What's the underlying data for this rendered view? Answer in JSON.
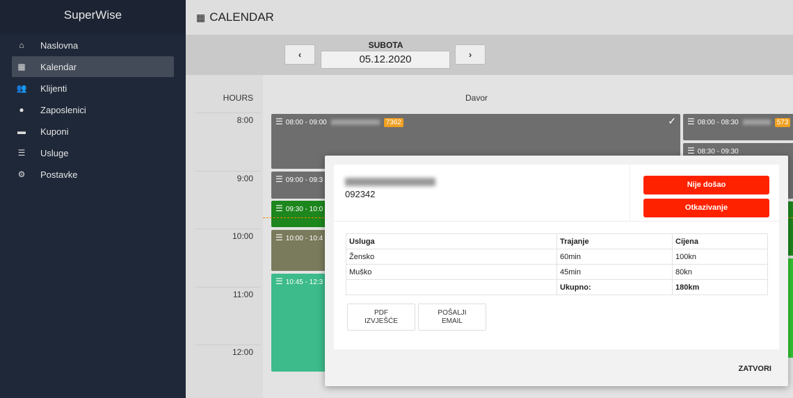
{
  "sidebar": {
    "brand": "SuperWise",
    "items": [
      {
        "label": "Naslovna",
        "icon": "home-icon",
        "glyph": "⌂"
      },
      {
        "label": "Kalendar",
        "icon": "calendar-icon",
        "glyph": "▦",
        "active": true
      },
      {
        "label": "Klijenti",
        "icon": "users-icon",
        "glyph": "👥"
      },
      {
        "label": "Zaposlenici",
        "icon": "user-icon",
        "glyph": "●"
      },
      {
        "label": "Kuponi",
        "icon": "ticket-icon",
        "glyph": "▬"
      },
      {
        "label": "Usluge",
        "icon": "list-icon",
        "glyph": "☰"
      },
      {
        "label": "Postavke",
        "icon": "gear-icon",
        "glyph": "⚙"
      }
    ]
  },
  "header": {
    "title": "CALENDAR",
    "icon": "calendar-icon"
  },
  "datenav": {
    "prev": "‹",
    "next": "›",
    "day": "SUBOTA",
    "date": "05.12.2020"
  },
  "calendar": {
    "hours_label": "HOURS",
    "hours": [
      "8:00",
      "9:00",
      "10:00",
      "11:00",
      "12:00"
    ],
    "column": "Davor",
    "events": [
      {
        "time": "08:00 - 09:00",
        "badge": "7362",
        "checked": true,
        "color": "#6e6e6e"
      },
      {
        "time": "09:00 - 09:3",
        "color": "#6e6e6e"
      },
      {
        "time": "09:30 - 10:0",
        "color": "#1d861d"
      },
      {
        "time": "10:00 - 10:4",
        "color": "#7a7a5c"
      },
      {
        "time": "10:45 - 12:3",
        "color": "#3dbb8a"
      },
      {
        "time": "08:00 - 08:30",
        "badge": "573",
        "color": "#6e6e6e"
      },
      {
        "time": "08:30 - 09:30",
        "color": "#6e6e6e"
      }
    ]
  },
  "modal": {
    "phone": "092342",
    "no_show": "Nije došao",
    "cancel": "Otkazivanje",
    "table": {
      "headers": [
        "Usluga",
        "Trajanje",
        "Cijena"
      ],
      "rows": [
        [
          "Žensko",
          "60min",
          "100kn"
        ],
        [
          "Muško",
          "45min",
          "80kn"
        ]
      ],
      "total_label": "Ukupno:",
      "total": "180km"
    },
    "pdf": "PDF IZVJEŠĆE",
    "email": "POŠALJI EMAIL",
    "close": "ZATVORI"
  },
  "colors": {
    "accent": "#ff2200",
    "sidebar": "#1f2838"
  }
}
